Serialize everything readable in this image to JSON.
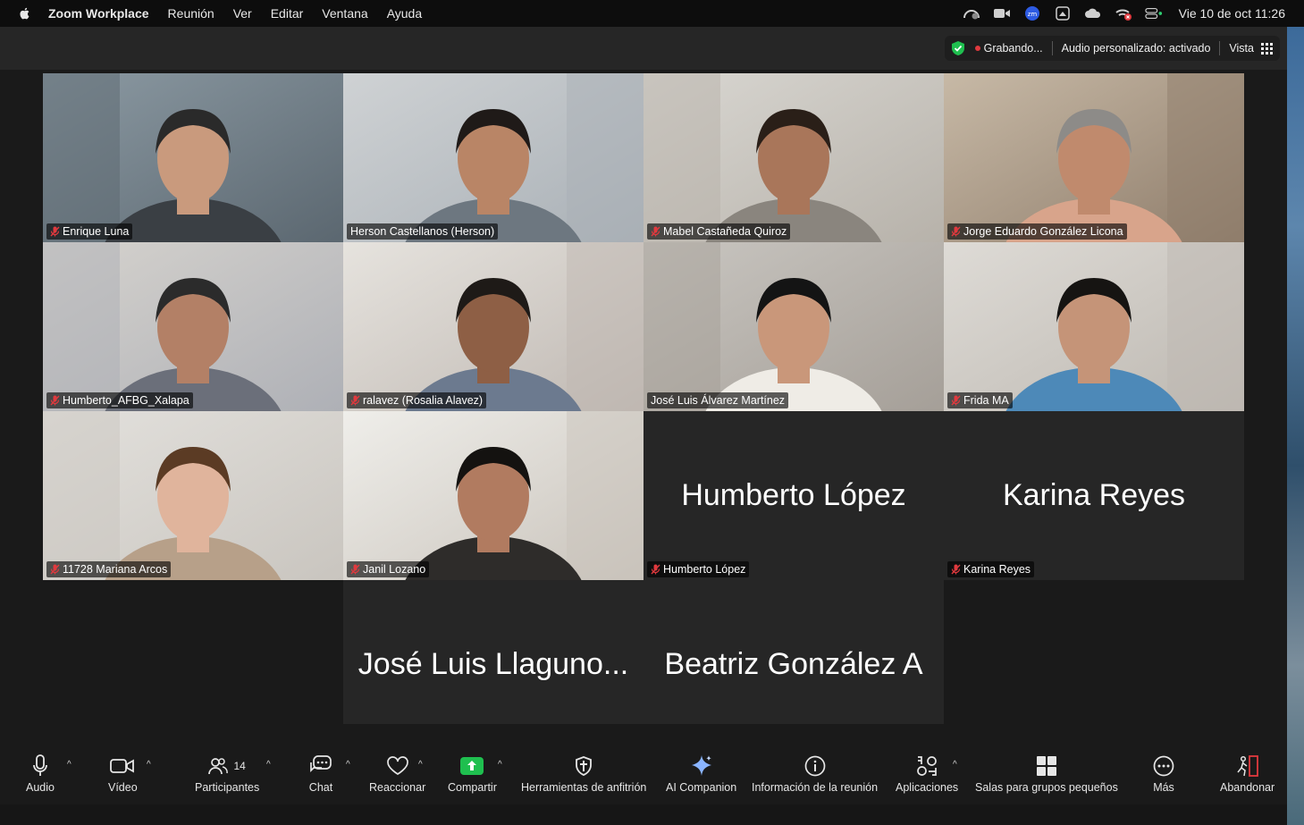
{
  "menubar": {
    "app_name": "Zoom Workplace",
    "menus": [
      "Reunión",
      "Ver",
      "Editar",
      "Ventana",
      "Ayuda"
    ],
    "status_icons": [
      "speed-icon",
      "camera-icon",
      "zoom-icon",
      "screen-record-icon",
      "creative-cloud-icon",
      "wifi-off-icon",
      "control-center-icon"
    ],
    "clock": "Vie 10 de oct  11:26"
  },
  "topbar": {
    "recording_label": "Grabando...",
    "audio_label": "Audio personalizado: activado",
    "view_label": "Vista",
    "colors": {
      "shield": "#1fbf4f",
      "recording": "#e0393e"
    }
  },
  "participants": [
    {
      "name": "Enrique Luna",
      "muted": true,
      "video": true
    },
    {
      "name": "Herson Castellanos (Herson)",
      "muted": false,
      "video": true
    },
    {
      "name": "Mabel Castañeda Quiroz",
      "muted": true,
      "video": true
    },
    {
      "name": "Jorge Eduardo González Licona",
      "muted": true,
      "video": true
    },
    {
      "name": "Humberto_AFBG_Xalapa",
      "muted": true,
      "video": true
    },
    {
      "name": "ralavez (Rosalia Alavez)",
      "muted": true,
      "video": true
    },
    {
      "name": "José Luis Álvarez Martínez",
      "muted": false,
      "video": true,
      "active_speaker": true
    },
    {
      "name": "Frida MA",
      "muted": true,
      "video": true
    },
    {
      "name": "11728 Mariana Arcos",
      "muted": true,
      "video": true
    },
    {
      "name": "Janil Lozano",
      "muted": true,
      "video": true
    },
    {
      "name": "Humberto López",
      "display": "Humberto López",
      "muted": true,
      "video": false
    },
    {
      "name": "Karina Reyes",
      "display": "Karina Reyes",
      "muted": true,
      "video": false
    },
    {
      "name": "José Luis Llaguno Roque",
      "display": "José Luis Llaguno...",
      "muted": false,
      "video": false
    },
    {
      "name": "Beatriz González A",
      "display": "Beatriz González A",
      "muted": true,
      "video": false
    }
  ],
  "toolbar": {
    "audio": "Audio",
    "video": "Vídeo",
    "participants": "Participantes",
    "participants_count": "14",
    "chat": "Chat",
    "reactions": "Reaccionar",
    "share": "Compartir",
    "host_tools": "Herramientas de anfitrión",
    "ai_companion": "AI Companion",
    "meeting_info": "Información de la reunión",
    "apps": "Aplicaciones",
    "breakout": "Salas para grupos pequeños",
    "more": "Más",
    "leave": "Abandonar",
    "colors": {
      "share": "#1fbf4f",
      "leave": "#e0393e"
    }
  }
}
